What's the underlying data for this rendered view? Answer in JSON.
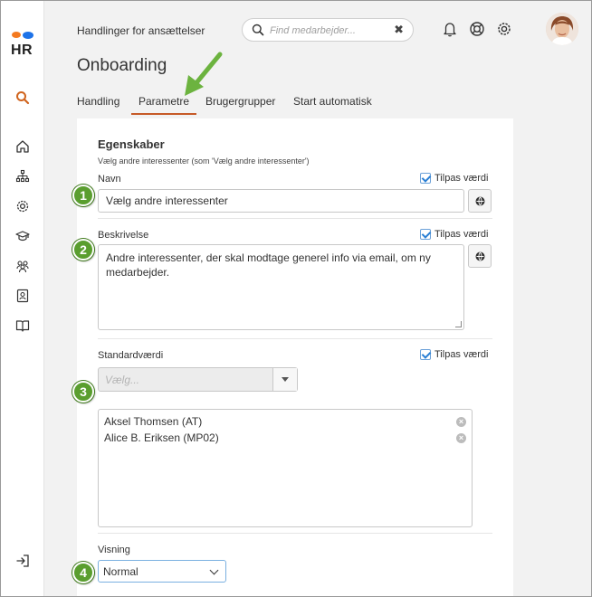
{
  "app": {
    "logo_text": "HR"
  },
  "header": {
    "subtitle": "Handlinger for ansættelser",
    "search_placeholder": "Find medarbejder...",
    "clear_glyph": "✖",
    "page_title": "Onboarding"
  },
  "tabs": [
    {
      "label": "Handling"
    },
    {
      "label": "Parametre"
    },
    {
      "label": "Brugergrupper"
    },
    {
      "label": "Start automatisk"
    }
  ],
  "form": {
    "section_title": "Egenskaber",
    "section_hint": "Vælg andre interessenter (som 'Vælg andre interessenter')",
    "tilpas_label": "Tilpas værdi",
    "name": {
      "label": "Navn",
      "value": "Vælg andre interessenter"
    },
    "description": {
      "label": "Beskrivelse",
      "value": "Andre interessenter, der skal modtage generel info via email, om ny medarbejder."
    },
    "default_value": {
      "label": "Standardværdi",
      "select_placeholder": "Vælg...",
      "items": [
        {
          "text": "Aksel Thomsen (AT)"
        },
        {
          "text": "Alice B. Eriksen (MP02)"
        }
      ],
      "remove_glyph": "×"
    },
    "view": {
      "label": "Visning",
      "value": "Normal"
    }
  },
  "badges": [
    "1",
    "2",
    "3",
    "4"
  ],
  "colors": {
    "accent": "#c65a27",
    "badge_green": "#5a9e2f",
    "arrow_green": "#6cb33f",
    "check_blue": "#2a7fd4"
  }
}
